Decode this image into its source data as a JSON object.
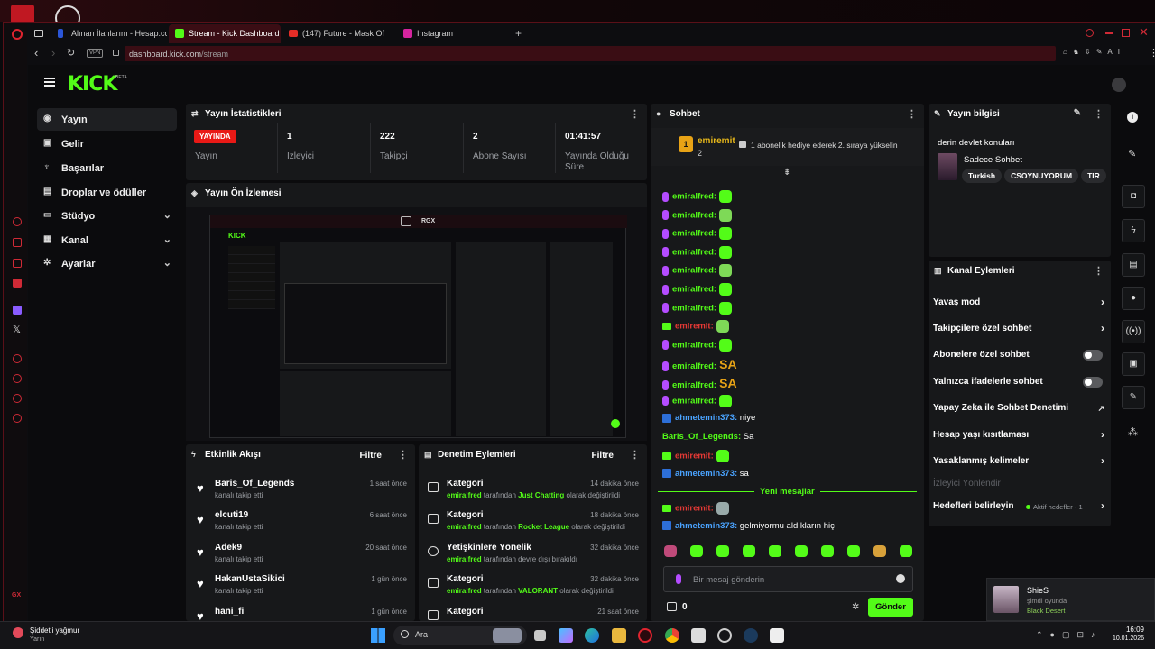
{
  "browser": {
    "tabs": [
      {
        "label": "Alınan İlanlarım - Hesap.co"
      },
      {
        "label": "Stream - Kick Dashboard"
      },
      {
        "label": "(147) Future - Mask Of"
      },
      {
        "label": "Instagram"
      }
    ],
    "vpn": "VPN",
    "url": "dashboard.kick.com/stream",
    "url_host": "dashboard.kick.com",
    "url_path": "/stream"
  },
  "kick": {
    "logo": "KICK",
    "beta": "BETA",
    "nav": [
      {
        "label": "Yayın",
        "icon": "broadcast-icon"
      },
      {
        "label": "Gelir",
        "icon": "money-icon"
      },
      {
        "label": "Başarılar",
        "icon": "trophy-icon"
      },
      {
        "label": "Droplar ve ödüller",
        "icon": "gift-icon"
      },
      {
        "label": "Stüdyo",
        "icon": "studio-icon"
      },
      {
        "label": "Kanal",
        "icon": "channel-icon"
      },
      {
        "label": "Ayarlar",
        "icon": "gear-icon"
      }
    ]
  },
  "stats": {
    "title": "Yayın İstatistikleri",
    "live_badge": "YAYINDA",
    "live_label": "Yayın",
    "items": [
      {
        "value": "1",
        "label": "İzleyici"
      },
      {
        "value": "222",
        "label": "Takipçi"
      },
      {
        "value": "2",
        "label": "Abone Sayısı"
      },
      {
        "value": "01:41:57",
        "label": "Yayında Olduğu Süre"
      }
    ]
  },
  "preview": {
    "title": "Yayın Ön İzlemesi",
    "rgx": "RGX"
  },
  "activity": {
    "title": "Etkinlik Akışı",
    "filter": "Filtre",
    "items": [
      {
        "name": "Baris_Of_Legends",
        "sub": "kanalı takip etti",
        "time": "1 saat önce"
      },
      {
        "name": "elcuti19",
        "sub": "kanalı takip etti",
        "time": "6 saat önce"
      },
      {
        "name": "Adek9",
        "sub": "kanalı takip etti",
        "time": "20 saat önce"
      },
      {
        "name": "HakanUstaSikici",
        "sub": "kanalı takip etti",
        "time": "1 gün önce"
      },
      {
        "name": "hani_fi",
        "sub": "",
        "time": "1 gün önce"
      }
    ]
  },
  "moderation": {
    "title": "Denetim Eylemleri",
    "filter": "Filtre",
    "items": [
      {
        "name": "Kategori",
        "user": "emiralfred",
        "mid": " tarafından ",
        "target": "Just Chatting",
        "end": " olarak değiştirildi",
        "time": "14 dakika önce"
      },
      {
        "name": "Kategori",
        "user": "emiralfred",
        "mid": " tarafından ",
        "target": "Rocket League",
        "end": " olarak değiştirildi",
        "time": "18 dakika önce"
      },
      {
        "name": "Yetişkinlere Yönelik",
        "user": "emiralfred",
        "mid": " tarafından devre dışı bırakıldı",
        "target": "",
        "end": "",
        "time": "32 dakika önce"
      },
      {
        "name": "Kategori",
        "user": "emiralfred",
        "mid": " tarafından ",
        "target": "VALORANT",
        "end": " olarak değiştirildi",
        "time": "32 dakika önce"
      },
      {
        "name": "Kategori",
        "user": "",
        "mid": "",
        "target": "",
        "end": "",
        "time": "21 saat önce"
      }
    ]
  },
  "chat": {
    "title": "Sohbet",
    "pinned_user": "emiremit",
    "pinned_count": "2",
    "pinned_msg": "1 abonelik hediye ederek 2. sıraya yükselin",
    "lines": [
      {
        "user": "emiralfred:",
        "text": ""
      },
      {
        "user": "emiralfred:",
        "text": ""
      },
      {
        "user": "emiralfred:",
        "text": ""
      },
      {
        "user": "emiralfred:",
        "text": ""
      },
      {
        "user": "emiralfred:",
        "text": ""
      },
      {
        "user": "emiralfred:",
        "text": ""
      },
      {
        "user": "emiralfred:",
        "text": ""
      },
      {
        "user": "emiremit:",
        "text": ""
      },
      {
        "user": "emiralfred:",
        "text": ""
      },
      {
        "user": "emiralfred:",
        "text": ""
      },
      {
        "user": "emiralfred:",
        "text": ""
      },
      {
        "user": "emiralfred:",
        "text": ""
      },
      {
        "user": "ahmetemin373:",
        "text": " niye"
      },
      {
        "user": "Baris_Of_Legends:",
        "text": " Sa"
      },
      {
        "user": "emiremit:",
        "text": ""
      },
      {
        "user": "ahmetemin373:",
        "text": " sa"
      }
    ],
    "new_messages": "Yeni mesajlar",
    "after": [
      {
        "user": "emiremit:",
        "text": ""
      },
      {
        "user": "ahmetemin373:",
        "text": " gelmiyormu aldıkların hiç"
      }
    ],
    "emote_sa": "SA",
    "input_placeholder": "Bir mesaj gönderin",
    "points": "0",
    "send": "Gönder"
  },
  "stream_info": {
    "title": "Yayın bilgisi",
    "stream_title": "derin devlet konuları",
    "category": "Sadece Sohbet",
    "tags": [
      "Turkish",
      "CSOYNUYORUM",
      "TIR"
    ]
  },
  "channel_actions": {
    "title": "Kanal Eylemleri",
    "items": [
      {
        "label": "Yavaş mod",
        "type": "chevron"
      },
      {
        "label": "Takipçilere özel sohbet",
        "type": "chevron"
      },
      {
        "label": "Abonelere özel sohbet",
        "type": "toggle"
      },
      {
        "label": "Yalnızca ifadelerle sohbet",
        "type": "toggle"
      },
      {
        "label": "Yapay Zeka ile Sohbet Denetimi",
        "type": "external"
      },
      {
        "label": "Hesap yaşı kısıtlaması",
        "type": "chevron"
      },
      {
        "label": "Yasaklanmış kelimeler",
        "type": "chevron"
      }
    ],
    "disabled": "İzleyici Yönlendir",
    "goals": "Hedefleri belirleyin",
    "goals_status": "Aktif hedefler - 1"
  },
  "notification": {
    "name": "ShieS",
    "line1": "şimdi oyunda",
    "game": "Black Desert"
  },
  "taskbar": {
    "weather": "Şiddetli yağmur",
    "weather_sub": "Yarın",
    "search": "Ara",
    "time": "16:09",
    "date": "10.01.2026"
  },
  "colors": {
    "accent": "#53fc18",
    "live": "#e91916",
    "frame": "#5a1018"
  }
}
